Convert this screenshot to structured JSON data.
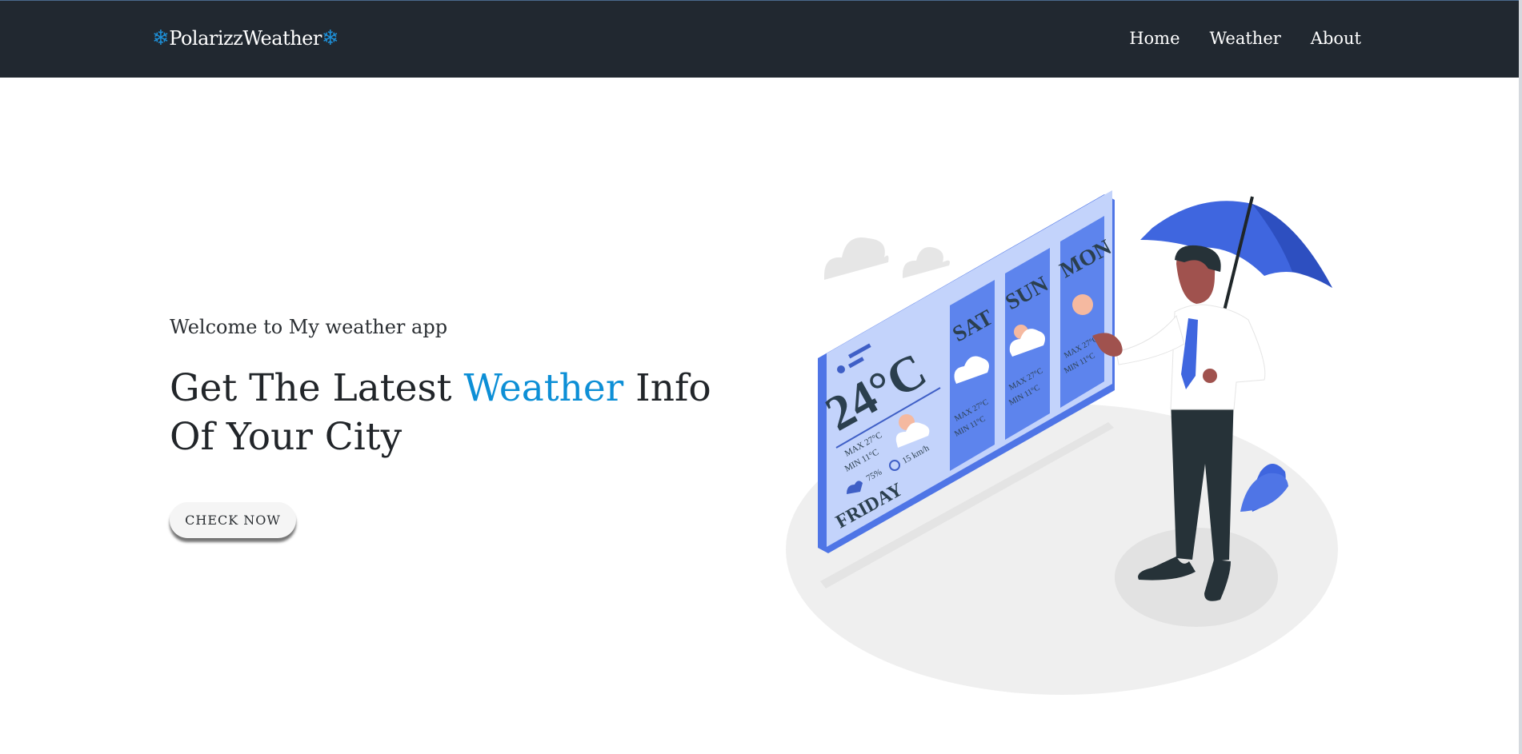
{
  "navbar": {
    "brand": "PolarizzWeather",
    "links": [
      "Home",
      "Weather",
      "About"
    ]
  },
  "hero": {
    "welcome": "Welcome to My weather app",
    "headline_pre": "Get The Latest ",
    "headline_accent": "Weather",
    "headline_post": " Info Of Your City",
    "cta_label": "CHECK NOW"
  },
  "illustration": {
    "temperature": "24°C",
    "today": "FRIDAY",
    "today_max": "MAX 27°C",
    "today_min": "MIN 11°C",
    "humidity": "75%",
    "wind": "15 km/h",
    "days": [
      {
        "day": "SAT",
        "max": "MAX 27°C",
        "min": "MIN 11°C"
      },
      {
        "day": "SUN",
        "max": "MAX 27°C",
        "min": "MIN 11°C"
      },
      {
        "day": "MON",
        "max": "MAX 27°C",
        "min": "MIN 11°C"
      }
    ]
  },
  "colors": {
    "navbar_bg": "#212830",
    "accent": "#0d8fd6",
    "panel_blue": "#5d84ed",
    "panel_light": "#c3d3fb"
  }
}
